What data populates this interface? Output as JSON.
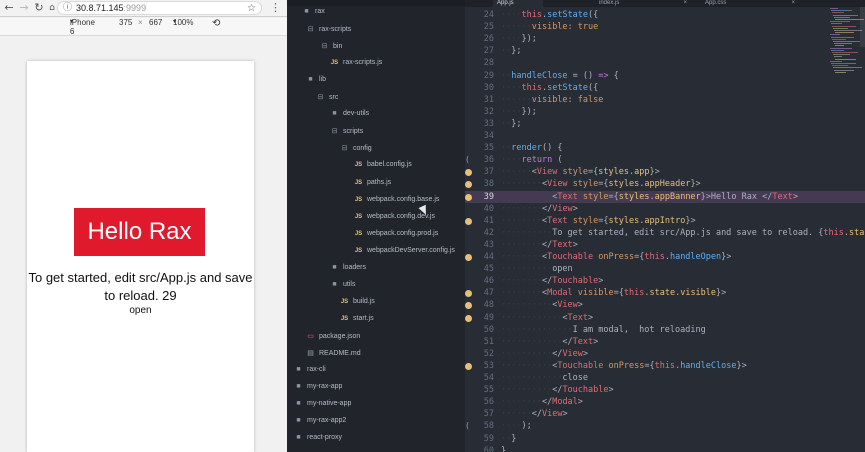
{
  "browser": {
    "url_host": "30.8.71.145",
    "url_port": ":9999",
    "device": "iPhone 6",
    "width": "375",
    "times": "×",
    "height": "667",
    "zoom": "100%",
    "icons": [
      "back-icon",
      "forward-icon",
      "reload-icon",
      "home-icon",
      "info-icon",
      "star-icon",
      "menu-icon",
      "rotate-icon",
      "chevron-down-icon"
    ]
  },
  "app": {
    "banner_text": "Hello Rax",
    "intro_text": "To get started, edit src/App.js and save to reload. 29",
    "open_label": "open",
    "colors": {
      "banner": "#e1192c"
    }
  },
  "sidebar": {
    "items": [
      {
        "label": "rax",
        "kind": "folder"
      },
      {
        "label": "rax-scripts",
        "kind": "folder-open"
      },
      {
        "label": "bin",
        "kind": "folder-open"
      },
      {
        "label": "rax-scripts.js",
        "kind": "js"
      },
      {
        "label": "lib",
        "kind": "folder"
      },
      {
        "label": "src",
        "kind": "folder-open"
      },
      {
        "label": "dev-utils",
        "kind": "folder"
      },
      {
        "label": "scripts",
        "kind": "folder-open"
      },
      {
        "label": "config",
        "kind": "folder-open"
      },
      {
        "label": "babel.config.js",
        "kind": "js"
      },
      {
        "label": "paths.js",
        "kind": "js"
      },
      {
        "label": "webpack.config.base.js",
        "kind": "js"
      },
      {
        "label": "webpack.config.dev.js",
        "kind": "js"
      },
      {
        "label": "webpack.config.prod.js",
        "kind": "js"
      },
      {
        "label": "webpackDevServer.config.js",
        "kind": "js"
      },
      {
        "label": "loaders",
        "kind": "folder"
      },
      {
        "label": "utils",
        "kind": "folder"
      },
      {
        "label": "build.js",
        "kind": "js"
      },
      {
        "label": "start.js",
        "kind": "js"
      },
      {
        "label": "package.json",
        "kind": "pkg"
      },
      {
        "label": "README.md",
        "kind": "md"
      },
      {
        "label": "rax-cli",
        "kind": "folder"
      },
      {
        "label": "my-rax-app",
        "kind": "folder"
      },
      {
        "label": "my-native-app",
        "kind": "folder"
      },
      {
        "label": "my-rax-app2",
        "kind": "folder"
      },
      {
        "label": "react-proxy",
        "kind": "folder"
      }
    ]
  },
  "editor": {
    "tabs": [
      {
        "label": "App.js",
        "active": true
      },
      {
        "label": "index.js",
        "active": false
      },
      {
        "label": "App.css",
        "active": false
      }
    ],
    "close_glyph": "×",
    "fold_glyph": "(",
    "lines": [
      {
        "n": "24",
        "bp": false,
        "hl": false,
        "fold": false,
        "tokens": [
          [
            "ws",
            "····"
          ],
          [
            "th",
            "this"
          ],
          [
            "pl",
            "."
          ],
          [
            "fn",
            "setState"
          ],
          [
            "pl",
            "({"
          ]
        ]
      },
      {
        "n": "25",
        "bp": false,
        "hl": false,
        "fold": false,
        "tokens": [
          [
            "ws",
            "······"
          ],
          [
            "at",
            "visible"
          ],
          [
            "pl",
            ": "
          ],
          [
            "at",
            "true"
          ]
        ]
      },
      {
        "n": "26",
        "bp": false,
        "hl": false,
        "fold": false,
        "tokens": [
          [
            "ws",
            "····"
          ],
          [
            "pl",
            "});"
          ]
        ]
      },
      {
        "n": "27",
        "bp": false,
        "hl": false,
        "fold": false,
        "tokens": [
          [
            "ws",
            "··"
          ],
          [
            "pl",
            "};"
          ]
        ]
      },
      {
        "n": "28",
        "bp": false,
        "hl": false,
        "fold": false,
        "tokens": []
      },
      {
        "n": "29",
        "bp": false,
        "hl": false,
        "fold": false,
        "tokens": [
          [
            "ws",
            "··"
          ],
          [
            "fn",
            "handleClose"
          ],
          [
            "pl",
            " = () "
          ],
          [
            "kw",
            "=>"
          ],
          [
            "pl",
            " {"
          ]
        ]
      },
      {
        "n": "30",
        "bp": false,
        "hl": false,
        "fold": false,
        "tokens": [
          [
            "ws",
            "····"
          ],
          [
            "th",
            "this"
          ],
          [
            "pl",
            "."
          ],
          [
            "fn",
            "setState"
          ],
          [
            "pl",
            "({"
          ]
        ]
      },
      {
        "n": "31",
        "bp": false,
        "hl": false,
        "fold": false,
        "tokens": [
          [
            "ws",
            "······"
          ],
          [
            "at",
            "visible"
          ],
          [
            "pl",
            ": "
          ],
          [
            "at",
            "false"
          ]
        ]
      },
      {
        "n": "32",
        "bp": false,
        "hl": false,
        "fold": false,
        "tokens": [
          [
            "ws",
            "····"
          ],
          [
            "pl",
            "});"
          ]
        ]
      },
      {
        "n": "33",
        "bp": false,
        "hl": false,
        "fold": false,
        "tokens": [
          [
            "ws",
            "··"
          ],
          [
            "pl",
            "};"
          ]
        ]
      },
      {
        "n": "34",
        "bp": false,
        "hl": false,
        "fold": false,
        "tokens": []
      },
      {
        "n": "35",
        "bp": false,
        "hl": false,
        "fold": false,
        "tokens": [
          [
            "ws",
            "··"
          ],
          [
            "fn",
            "render"
          ],
          [
            "pl",
            "() {"
          ]
        ]
      },
      {
        "n": "36",
        "bp": false,
        "hl": false,
        "fold": true,
        "tokens": [
          [
            "ws",
            "····"
          ],
          [
            "kw",
            "return"
          ],
          [
            "pl",
            " ("
          ]
        ]
      },
      {
        "n": "37",
        "bp": true,
        "hl": false,
        "fold": false,
        "tokens": [
          [
            "ws",
            "······"
          ],
          [
            "pl",
            "<"
          ],
          [
            "tag",
            "View"
          ],
          [
            "pl",
            " "
          ],
          [
            "at",
            "style"
          ],
          [
            "pl",
            "={"
          ],
          [
            "pr",
            "styles"
          ],
          [
            "pl",
            "."
          ],
          [
            "pr",
            "app"
          ],
          [
            "pl",
            "}>"
          ]
        ]
      },
      {
        "n": "38",
        "bp": true,
        "hl": false,
        "fold": false,
        "tokens": [
          [
            "ws",
            "········"
          ],
          [
            "pl",
            "<"
          ],
          [
            "tag",
            "View"
          ],
          [
            "pl",
            " "
          ],
          [
            "at",
            "style"
          ],
          [
            "pl",
            "={"
          ],
          [
            "pr",
            "styles"
          ],
          [
            "pl",
            "."
          ],
          [
            "pr",
            "appHeader"
          ],
          [
            "pl",
            "}>"
          ]
        ]
      },
      {
        "n": "39",
        "bp": true,
        "hl": true,
        "fold": false,
        "tokens": [
          [
            "ws",
            "··········"
          ],
          [
            "pl",
            "<"
          ],
          [
            "tag",
            "Text"
          ],
          [
            "pl",
            " "
          ],
          [
            "at",
            "style"
          ],
          [
            "pl",
            "={"
          ],
          [
            "pr",
            "styles"
          ],
          [
            "pl",
            "."
          ],
          [
            "pr",
            "appBanner"
          ],
          [
            "pl",
            "}>Hello Rax </"
          ],
          [
            "tag",
            "Text"
          ],
          [
            "pl",
            ">"
          ]
        ]
      },
      {
        "n": "40",
        "bp": false,
        "hl": false,
        "fold": false,
        "tokens": [
          [
            "ws",
            "········"
          ],
          [
            "pl",
            "</"
          ],
          [
            "tag",
            "View"
          ],
          [
            "pl",
            ">"
          ]
        ]
      },
      {
        "n": "41",
        "bp": true,
        "hl": false,
        "fold": false,
        "tokens": [
          [
            "ws",
            "········"
          ],
          [
            "pl",
            "<"
          ],
          [
            "tag",
            "Text"
          ],
          [
            "pl",
            " "
          ],
          [
            "at",
            "style"
          ],
          [
            "pl",
            "={"
          ],
          [
            "pr",
            "styles"
          ],
          [
            "pl",
            "."
          ],
          [
            "pr",
            "appIntro"
          ],
          [
            "pl",
            "}>"
          ]
        ]
      },
      {
        "n": "42",
        "bp": false,
        "hl": false,
        "fold": false,
        "tokens": [
          [
            "ws",
            "··········"
          ],
          [
            "pl",
            "To get started, edit src/App.js and save to reload. {"
          ],
          [
            "th",
            "this"
          ],
          [
            "pl",
            "."
          ],
          [
            "pr",
            "sta"
          ]
        ]
      },
      {
        "n": "43",
        "bp": false,
        "hl": false,
        "fold": false,
        "tokens": [
          [
            "ws",
            "········"
          ],
          [
            "pl",
            "</"
          ],
          [
            "tag",
            "Text"
          ],
          [
            "pl",
            ">"
          ]
        ]
      },
      {
        "n": "44",
        "bp": true,
        "hl": false,
        "fold": false,
        "tokens": [
          [
            "ws",
            "········"
          ],
          [
            "pl",
            "<"
          ],
          [
            "tag",
            "Touchable"
          ],
          [
            "pl",
            " "
          ],
          [
            "at",
            "onPress"
          ],
          [
            "pl",
            "={"
          ],
          [
            "th",
            "this"
          ],
          [
            "pl",
            "."
          ],
          [
            "fn",
            "handleOpen"
          ],
          [
            "pl",
            "}>"
          ]
        ]
      },
      {
        "n": "45",
        "bp": false,
        "hl": false,
        "fold": false,
        "tokens": [
          [
            "ws",
            "··········"
          ],
          [
            "pl",
            "open"
          ]
        ]
      },
      {
        "n": "46",
        "bp": false,
        "hl": false,
        "fold": false,
        "tokens": [
          [
            "ws",
            "········"
          ],
          [
            "pl",
            "</"
          ],
          [
            "tag",
            "Touchable"
          ],
          [
            "pl",
            ">"
          ]
        ]
      },
      {
        "n": "47",
        "bp": true,
        "hl": false,
        "fold": false,
        "tokens": [
          [
            "ws",
            "········"
          ],
          [
            "pl",
            "<"
          ],
          [
            "tag",
            "Modal"
          ],
          [
            "pl",
            " "
          ],
          [
            "at",
            "visible"
          ],
          [
            "pl",
            "={"
          ],
          [
            "th",
            "this"
          ],
          [
            "pl",
            "."
          ],
          [
            "pr",
            "state"
          ],
          [
            "pl",
            "."
          ],
          [
            "pr",
            "visible"
          ],
          [
            "pl",
            "}>"
          ]
        ]
      },
      {
        "n": "48",
        "bp": true,
        "hl": false,
        "fold": false,
        "tokens": [
          [
            "ws",
            "··········"
          ],
          [
            "pl",
            "<"
          ],
          [
            "tag",
            "View"
          ],
          [
            "pl",
            ">"
          ]
        ]
      },
      {
        "n": "49",
        "bp": true,
        "hl": false,
        "fold": false,
        "tokens": [
          [
            "ws",
            "············"
          ],
          [
            "pl",
            "<"
          ],
          [
            "tag",
            "Text"
          ],
          [
            "pl",
            ">"
          ]
        ]
      },
      {
        "n": "50",
        "bp": false,
        "hl": false,
        "fold": false,
        "tokens": [
          [
            "ws",
            "··············"
          ],
          [
            "pl",
            "I am modal,  hot reloading"
          ]
        ]
      },
      {
        "n": "51",
        "bp": false,
        "hl": false,
        "fold": false,
        "tokens": [
          [
            "ws",
            "············"
          ],
          [
            "pl",
            "</"
          ],
          [
            "tag",
            "Text"
          ],
          [
            "pl",
            ">"
          ]
        ]
      },
      {
        "n": "52",
        "bp": false,
        "hl": false,
        "fold": false,
        "tokens": [
          [
            "ws",
            "··········"
          ],
          [
            "pl",
            "</"
          ],
          [
            "tag",
            "View"
          ],
          [
            "pl",
            ">"
          ]
        ]
      },
      {
        "n": "53",
        "bp": true,
        "hl": false,
        "fold": false,
        "tokens": [
          [
            "ws",
            "··········"
          ],
          [
            "pl",
            "<"
          ],
          [
            "tag",
            "Touchable"
          ],
          [
            "pl",
            " "
          ],
          [
            "at",
            "onPress"
          ],
          [
            "pl",
            "={"
          ],
          [
            "th",
            "this"
          ],
          [
            "pl",
            "."
          ],
          [
            "fn",
            "handleClose"
          ],
          [
            "pl",
            "}>"
          ]
        ]
      },
      {
        "n": "54",
        "bp": false,
        "hl": false,
        "fold": false,
        "tokens": [
          [
            "ws",
            "············"
          ],
          [
            "pl",
            "close"
          ]
        ]
      },
      {
        "n": "55",
        "bp": false,
        "hl": false,
        "fold": false,
        "tokens": [
          [
            "ws",
            "··········"
          ],
          [
            "pl",
            "</"
          ],
          [
            "tag",
            "Touchable"
          ],
          [
            "pl",
            ">"
          ]
        ]
      },
      {
        "n": "56",
        "bp": false,
        "hl": false,
        "fold": false,
        "tokens": [
          [
            "ws",
            "········"
          ],
          [
            "pl",
            "</"
          ],
          [
            "tag",
            "Modal"
          ],
          [
            "pl",
            ">"
          ]
        ]
      },
      {
        "n": "57",
        "bp": false,
        "hl": false,
        "fold": false,
        "tokens": [
          [
            "ws",
            "······"
          ],
          [
            "pl",
            "</"
          ],
          [
            "tag",
            "View"
          ],
          [
            "pl",
            ">"
          ]
        ]
      },
      {
        "n": "58",
        "bp": false,
        "hl": false,
        "fold": true,
        "tokens": [
          [
            "ws",
            "····"
          ],
          [
            "pl",
            ");"
          ]
        ]
      },
      {
        "n": "59",
        "bp": false,
        "hl": false,
        "fold": false,
        "tokens": [
          [
            "ws",
            "··"
          ],
          [
            "pl",
            "}"
          ]
        ]
      },
      {
        "n": "60",
        "bp": false,
        "hl": false,
        "fold": false,
        "tokens": [
          [
            "pl",
            "}"
          ]
        ]
      }
    ]
  }
}
